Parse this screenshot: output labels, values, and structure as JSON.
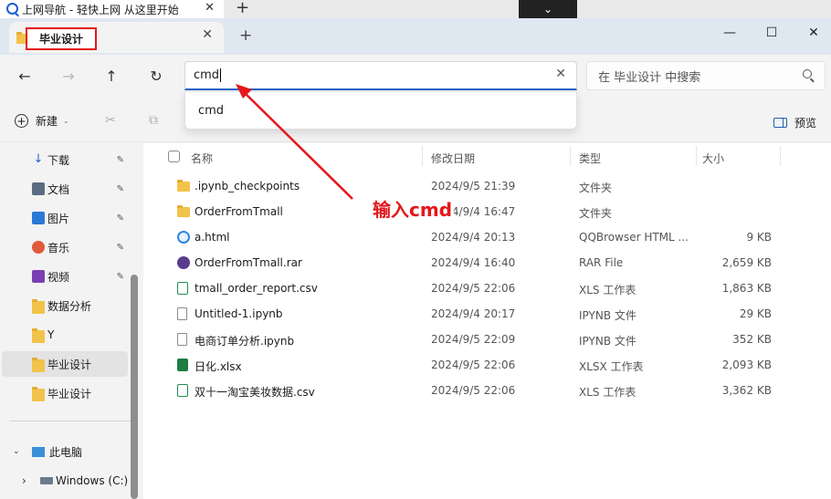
{
  "browser": {
    "tab_title": "上网导航 - 轻快上网 从这里开始",
    "tab_close": "✕",
    "new_tab": "+",
    "dropdown": "⌄"
  },
  "explorer": {
    "tab_label": "毕业设计",
    "tab_close": "✕",
    "new_tab": "+",
    "window_controls": {
      "minimize": "—",
      "maximize": "☐",
      "close": "✕"
    }
  },
  "nav": {
    "back": "←",
    "forward": "→",
    "up": "↑",
    "refresh": "↻",
    "address_value": "cmd",
    "clear": "✕",
    "search_placeholder": "在 毕业设计 中搜索"
  },
  "suggestion": {
    "item": "cmd"
  },
  "toolbar": {
    "new_label": "新建",
    "new_chevron": "⌄",
    "cut_icon": "✂",
    "copy_icon": "⧉",
    "preview_label": "预览"
  },
  "sidebar": {
    "items": [
      {
        "label": "下载",
        "icon": "download-icon",
        "pinned": true
      },
      {
        "label": "文档",
        "icon": "document-icon",
        "pinned": true
      },
      {
        "label": "图片",
        "icon": "picture-icon",
        "pinned": true
      },
      {
        "label": "音乐",
        "icon": "music-icon",
        "pinned": true
      },
      {
        "label": "视频",
        "icon": "video-icon",
        "pinned": true
      },
      {
        "label": "数据分析",
        "icon": "folder-icon",
        "pinned": false
      },
      {
        "label": "Y",
        "icon": "folder-icon",
        "pinned": false
      },
      {
        "label": "毕业设计",
        "icon": "folder-icon",
        "pinned": false,
        "selected": true
      },
      {
        "label": "毕业设计",
        "icon": "folder-icon",
        "pinned": false
      }
    ],
    "this_pc": "此电脑",
    "drive": "Windows (C:)",
    "pin_glyph": "📌",
    "expand_glyph": "⌄",
    "collapse_glyph": "›"
  },
  "columns": {
    "name": "名称",
    "date": "修改日期",
    "type": "类型",
    "size": "大小"
  },
  "files": [
    {
      "name": ".ipynb_checkpoints",
      "date": "2024/9/5 21:39",
      "type": "文件夹",
      "size": "",
      "icon": "folder-icon"
    },
    {
      "name": "OrderFromTmall",
      "date": "2024/9/4 16:47",
      "type": "文件夹",
      "size": "",
      "icon": "folder-icon"
    },
    {
      "name": "a.html",
      "date": "2024/9/4 20:13",
      "type": "QQBrowser HTML ...",
      "size": "9 KB",
      "icon": "html-file-icon"
    },
    {
      "name": "OrderFromTmall.rar",
      "date": "2024/9/4 16:40",
      "type": "RAR File",
      "size": "2,659 KB",
      "icon": "rar-file-icon"
    },
    {
      "name": "tmall_order_report.csv",
      "date": "2024/9/5 22:06",
      "type": "XLS 工作表",
      "size": "1,863 KB",
      "icon": "csv-file-icon"
    },
    {
      "name": "Untitled-1.ipynb",
      "date": "2024/9/4 20:17",
      "type": "IPYNB 文件",
      "size": "29 KB",
      "icon": "ipynb-file-icon"
    },
    {
      "name": "电商订单分析.ipynb",
      "date": "2024/9/5 22:09",
      "type": "IPYNB 文件",
      "size": "352 KB",
      "icon": "ipynb-file-icon"
    },
    {
      "name": "日化.xlsx",
      "date": "2024/9/5 22:06",
      "type": "XLSX 工作表",
      "size": "2,093 KB",
      "icon": "xlsx-file-icon"
    },
    {
      "name": "双十一淘宝美妆数据.csv",
      "date": "2024/9/5 22:06",
      "type": "XLS 工作表",
      "size": "3,362 KB",
      "icon": "csv-file-icon"
    }
  ],
  "annotation": {
    "text": "输入cmd",
    "color": "#e4171c"
  }
}
